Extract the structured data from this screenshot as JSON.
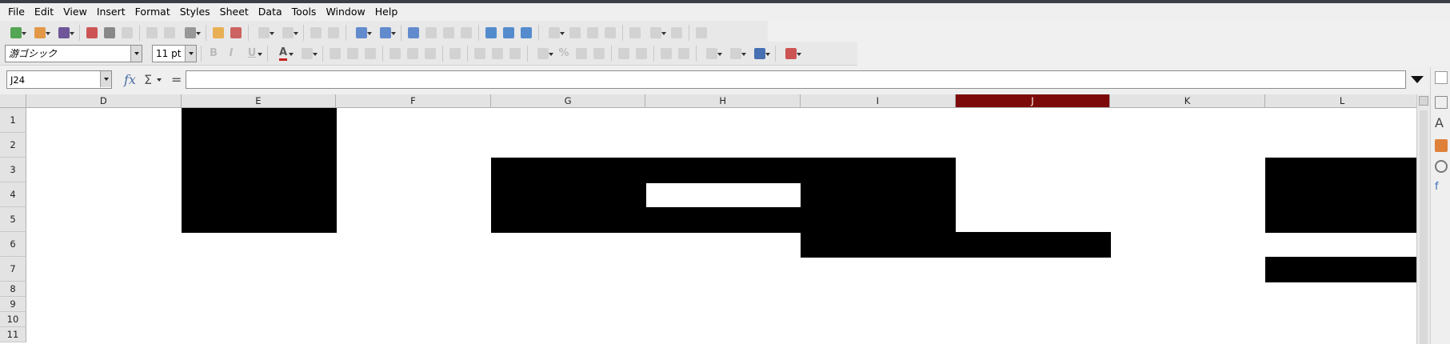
{
  "menu": [
    "File",
    "Edit",
    "View",
    "Insert",
    "Format",
    "Styles",
    "Sheet",
    "Data",
    "Tools",
    "Window",
    "Help"
  ],
  "toolbar_standard": [
    {
      "name": "new-icon",
      "dd": true
    },
    {
      "name": "open-icon",
      "dd": true
    },
    {
      "name": "save-icon",
      "dd": true
    },
    {
      "sep": true
    },
    {
      "name": "export-pdf-icon"
    },
    {
      "name": "print-icon"
    },
    {
      "name": "print-preview-icon"
    },
    {
      "sep": true
    },
    {
      "name": "cut-icon"
    },
    {
      "name": "copy-icon"
    },
    {
      "name": "paste-icon",
      "dd": true
    },
    {
      "sep": true
    },
    {
      "name": "clone-format-icon"
    },
    {
      "name": "clear-format-icon"
    },
    {
      "sep": true
    },
    {
      "name": "undo-icon",
      "dd": true
    },
    {
      "name": "redo-icon",
      "dd": true
    },
    {
      "sep": true
    },
    {
      "name": "find-replace-icon"
    },
    {
      "name": "spelling-icon"
    },
    {
      "sep": true
    },
    {
      "name": "row-icon",
      "dd": true
    },
    {
      "name": "column-icon",
      "dd": true
    },
    {
      "sep": true
    },
    {
      "name": "sort-icon"
    },
    {
      "name": "sort-ascending-icon"
    },
    {
      "name": "sort-descending-icon"
    },
    {
      "name": "autofilter-icon"
    },
    {
      "sep": true
    },
    {
      "name": "insert-image-icon"
    },
    {
      "name": "insert-chart-icon"
    },
    {
      "name": "pivot-table-icon"
    },
    {
      "sep": true
    },
    {
      "name": "special-character-icon",
      "dd": true
    },
    {
      "name": "hyperlink-icon"
    },
    {
      "name": "comment-icon"
    },
    {
      "name": "headers-footers-icon"
    },
    {
      "sep": true
    },
    {
      "name": "define-print-area-icon"
    },
    {
      "name": "freeze-rows-columns-icon",
      "dd": true
    },
    {
      "name": "split-window-icon"
    },
    {
      "sep": true
    },
    {
      "name": "show-draw-functions-icon"
    }
  ],
  "toolbar_formatting": {
    "font_name": "游ゴシック",
    "font_size": "11 pt",
    "buttons": [
      {
        "name": "bold-icon",
        "glyph": "B"
      },
      {
        "name": "italic-icon",
        "glyph": "I"
      },
      {
        "name": "underline-icon",
        "glyph": "U",
        "dd": true
      },
      {
        "sep": true
      },
      {
        "name": "font-color-icon",
        "glyph": "A",
        "dd": true
      },
      {
        "name": "highlight-color-icon",
        "glyph": "",
        "dd": true
      },
      {
        "sep": true
      },
      {
        "name": "align-left-icon"
      },
      {
        "name": "align-center-icon"
      },
      {
        "name": "align-right-icon"
      },
      {
        "sep": true
      },
      {
        "name": "align-top-icon"
      },
      {
        "name": "align-middle-icon"
      },
      {
        "name": "align-bottom-icon"
      },
      {
        "sep": true
      },
      {
        "name": "wrap-text-icon"
      },
      {
        "sep": true
      },
      {
        "name": "merge-center-icon"
      },
      {
        "name": "merge-cells-icon"
      },
      {
        "name": "unmerge-cells-icon"
      },
      {
        "sep": true
      },
      {
        "name": "currency-format-icon",
        "dd": true
      },
      {
        "name": "percent-format-icon",
        "glyph": "%"
      },
      {
        "name": "number-format-icon"
      },
      {
        "name": "date-format-icon"
      },
      {
        "sep": true
      },
      {
        "name": "add-decimal-icon"
      },
      {
        "name": "delete-decimal-icon"
      },
      {
        "sep": true
      },
      {
        "name": "increase-indent-icon"
      },
      {
        "name": "decrease-indent-icon"
      },
      {
        "sep": true
      },
      {
        "name": "borders-icon",
        "dd": true
      },
      {
        "name": "border-style-icon",
        "dd": true
      },
      {
        "name": "border-color-icon",
        "dd": true
      },
      {
        "sep": true
      },
      {
        "name": "conditional-format-icon",
        "dd": true
      }
    ]
  },
  "formula_bar": {
    "name_box": "J24",
    "fx_label": "fx",
    "sigma_label": "Σ",
    "equals_label": "=",
    "formula": ""
  },
  "sheet": {
    "columns": [
      {
        "label": "D"
      },
      {
        "label": "E"
      },
      {
        "label": "F"
      },
      {
        "label": "G"
      },
      {
        "label": "H"
      },
      {
        "label": "I"
      },
      {
        "label": "J",
        "active": true
      },
      {
        "label": "K"
      },
      {
        "label": "L"
      }
    ],
    "rows": [
      "1",
      "2",
      "3",
      "4",
      "5",
      "6",
      "7",
      "8",
      "9",
      "10",
      "11"
    ],
    "filled_cells": [
      "E1",
      "E2",
      "E3",
      "E4",
      "E5",
      "G3",
      "H3",
      "I3",
      "G4",
      "I4",
      "G5",
      "H5",
      "I5",
      "I6",
      "J6",
      "L3",
      "L4",
      "L5",
      "L7"
    ],
    "fill_color": "#000000",
    "active_column_color": "#7d0a0a"
  }
}
